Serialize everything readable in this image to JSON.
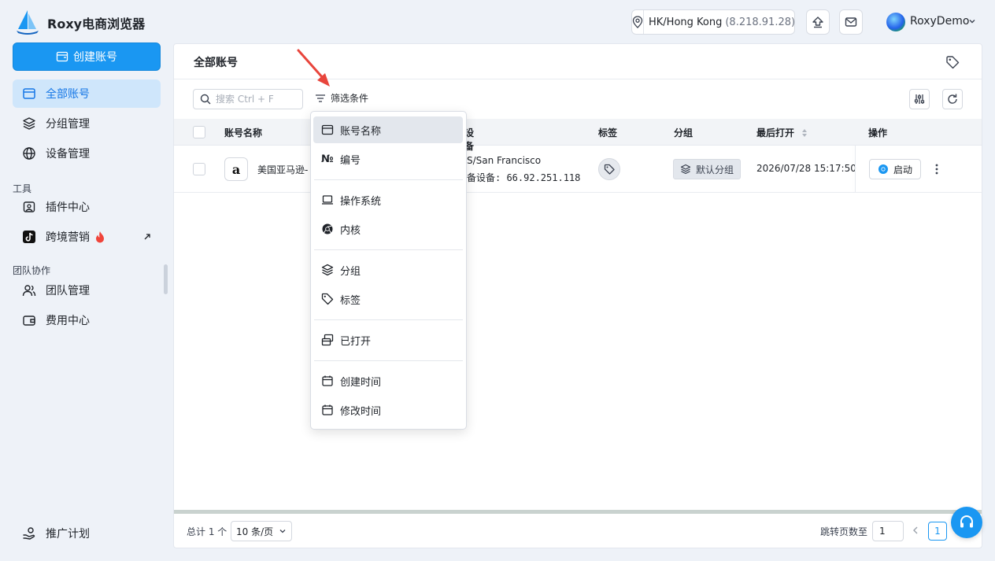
{
  "app": {
    "title": "Roxy电商浏览器"
  },
  "header": {
    "location": "HK/Hong Kong",
    "ip": "(8.218.91.28)",
    "user_name": "RoxyDemo"
  },
  "sidebar": {
    "create_label": "创建账号",
    "items": [
      {
        "label": "全部账号",
        "icon": "window-icon",
        "active": true
      },
      {
        "label": "分组管理",
        "icon": "layers-icon"
      },
      {
        "label": "设备管理",
        "icon": "globe-icon"
      }
    ],
    "section_tools": "工具",
    "tools": [
      {
        "label": "插件中心",
        "icon": "plugin-icon"
      },
      {
        "label": "跨境营销",
        "icon": "tiktok-icon"
      }
    ],
    "section_team": "团队协作",
    "team": [
      {
        "label": "团队管理",
        "icon": "users-icon"
      },
      {
        "label": "费用中心",
        "icon": "wallet-icon"
      }
    ],
    "promo_label": "推广计划"
  },
  "main": {
    "title": "全部账号",
    "search_placeholder": "搜索 Ctrl + F",
    "filter_label": "筛选条件",
    "columns": {
      "name": "账号名称",
      "device": "设备",
      "tags": "标签",
      "group": "分组",
      "last_open": "最后打开",
      "ops": "操作"
    },
    "row": {
      "name": "美国亚马逊-",
      "device_location": "S/San Francisco",
      "device_ip": "备设备: 66.92.251.118",
      "group": "默认分组",
      "last_open": "2026/07/28 15:17:50",
      "start_label": "启动"
    }
  },
  "footer": {
    "total": "总计 1 个",
    "page_size": "10 条/页",
    "jump_label": "跳转页数至",
    "jump_value": "1",
    "current_page": "1"
  },
  "dropdown": {
    "items": [
      {
        "label": "账号名称",
        "icon": "window-icon"
      },
      {
        "label": "编号",
        "icon": "number-icon"
      },
      {
        "label": "操作系统",
        "icon": "laptop-icon"
      },
      {
        "label": "内核",
        "icon": "chrome-icon"
      },
      {
        "label": "分组",
        "icon": "layers-icon"
      },
      {
        "label": "标签",
        "icon": "tag-icon"
      },
      {
        "label": "已打开",
        "icon": "windows-stack-icon"
      },
      {
        "label": "创建时间",
        "icon": "calendar-icon"
      },
      {
        "label": "修改时间",
        "icon": "calendar-icon"
      }
    ]
  },
  "colors": {
    "accent": "#1a97f2",
    "active_bg": "#cfe6fb",
    "annotation_arrow": "#e8453c"
  }
}
